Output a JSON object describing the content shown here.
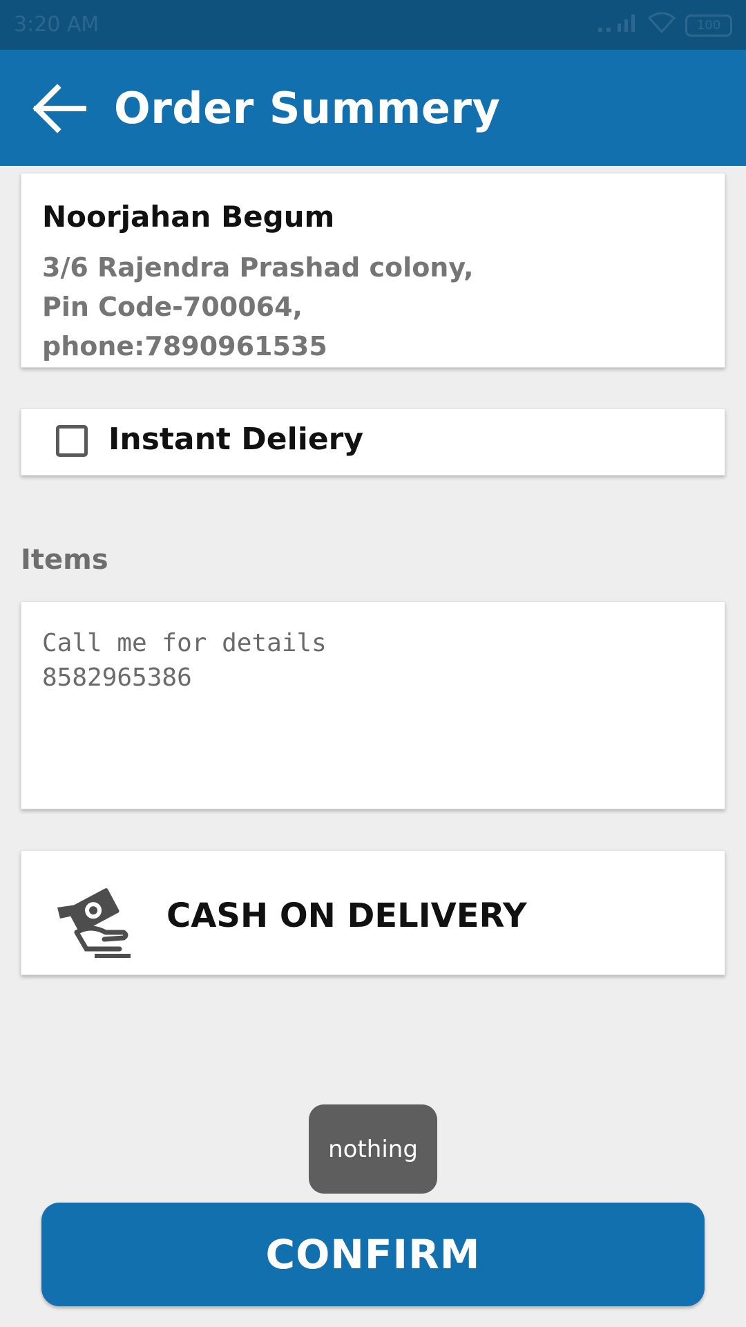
{
  "status_bar": {
    "time": "3:20 AM",
    "battery": "100"
  },
  "app_bar": {
    "title": "Order Summery",
    "back_icon": "arrow-left-icon"
  },
  "address": {
    "name": "Noorjahan Begum",
    "line1": "3/6 Rajendra Prashad colony,",
    "line2": "Pin Code-700064,",
    "line3": "phone:7890961535"
  },
  "instant_delivery": {
    "label": "Instant Deliery",
    "checked": false
  },
  "items": {
    "label": "Items",
    "text": "Call me for details\n8582965386"
  },
  "payment": {
    "label": "CASH ON DELIVERY",
    "icon": "cash-in-hand-icon"
  },
  "toast": {
    "text": "nothing"
  },
  "confirm": {
    "label": "CONFIRM"
  },
  "colors": {
    "primary": "#1170ad",
    "status_bar": "#0f527e",
    "background": "#eeeeee"
  }
}
